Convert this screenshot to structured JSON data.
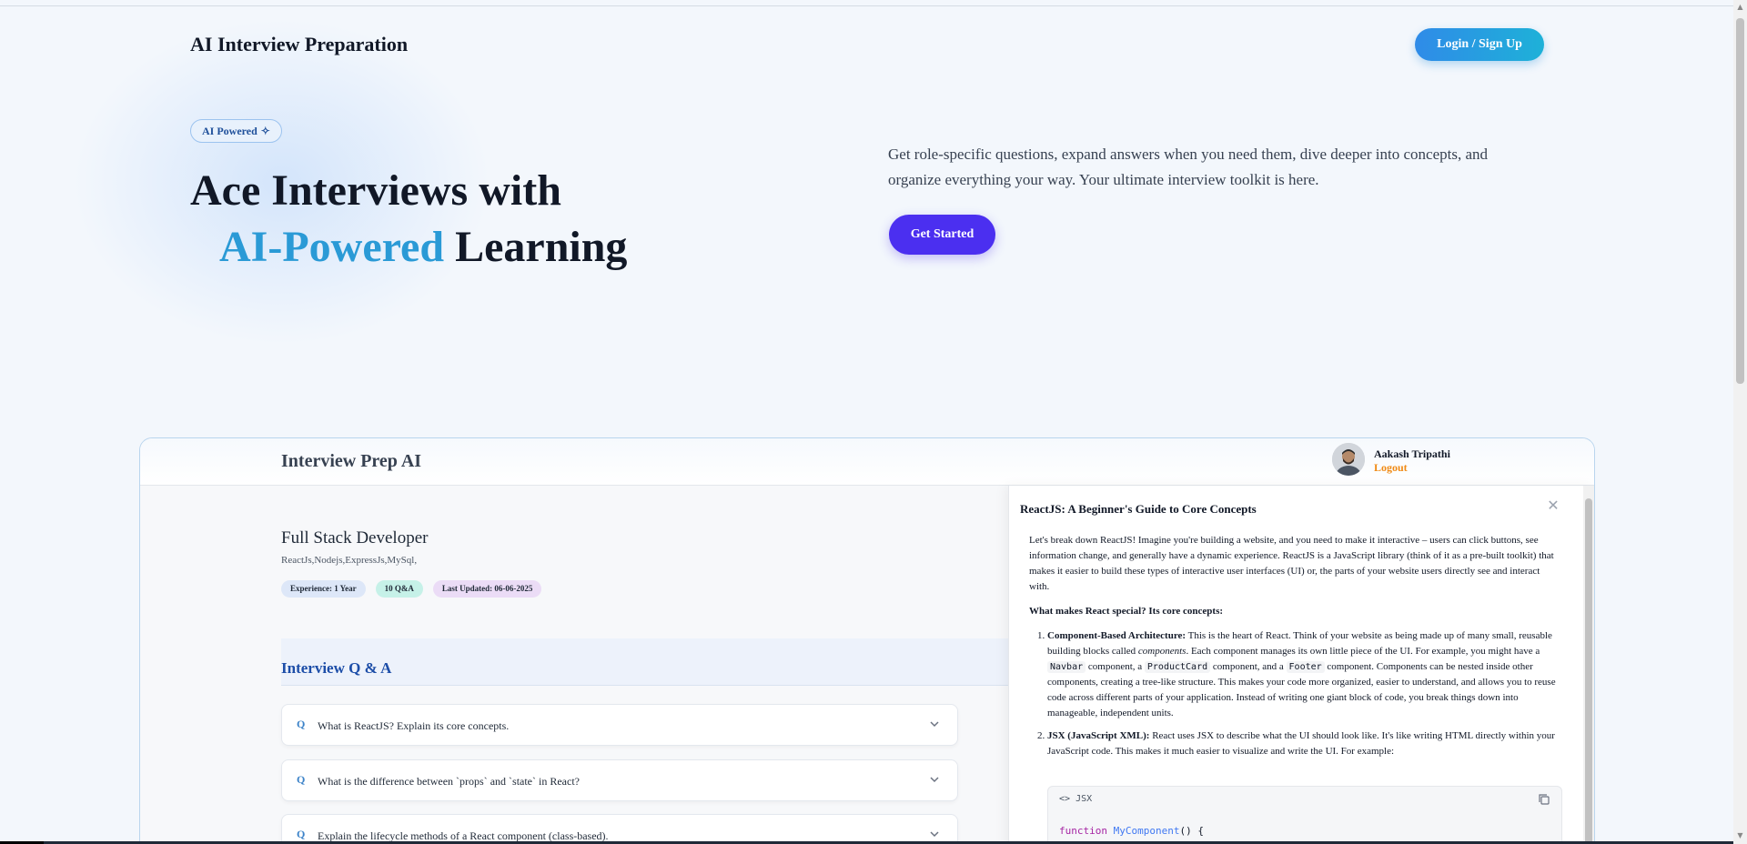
{
  "header": {
    "site_title": "AI Interview Preparation",
    "login_label": "Login / Sign Up"
  },
  "hero": {
    "badge": "AI Powered",
    "badge_icon": "sparkle-icon",
    "headline_line1": "Ace Interviews with",
    "headline_accent": "AI-Powered",
    "headline_rest": "Learning",
    "description": "Get role-specific questions, expand answers when you need them, dive deeper into concepts, and organize everything your way. Your ultimate interview toolkit is here.",
    "cta_label": "Get Started"
  },
  "preview": {
    "app_title": "Interview Prep AI",
    "user": {
      "name": "Aakash Tripathi",
      "logout_label": "Logout"
    },
    "session": {
      "role": "Full Stack Developer",
      "skills": "ReactJs,Nodejs,ExpressJs,MySql,",
      "tags": [
        "Experience: 1 Year",
        "10 Q&A",
        "Last Updated: 06-06-2025"
      ]
    },
    "qa_title": "Interview Q & A",
    "question_marker": "Q",
    "questions": [
      "What is ReactJS? Explain its core concepts.",
      "What is the difference between `props` and `state` in React?",
      "Explain the lifecycle methods of a React component (class-based)."
    ],
    "drawer": {
      "title": "ReactJS: A Beginner's Guide to Core Concepts",
      "close_icon": "close-icon",
      "intro": "Let's break down ReactJS! Imagine you're building a website, and you need to make it interactive – users can click buttons, see information change, and generally have a dynamic experience. ReactJS is a JavaScript library (think of it as a pre-built toolkit) that makes it easier to build these types of interactive user interfaces (UI) or, the parts of your website users directly see and interact with.",
      "subheading": "What makes React special? Its core concepts:",
      "items": [
        {
          "term": "Component-Based Architecture:",
          "text_a": " This is the heart of React. Think of your website as being made up of many small, reusable building blocks called ",
          "em": "components",
          "text_b": ". Each component manages its own little piece of the UI. For example, you might have a ",
          "code1": "Navbar",
          "text_c": " component, a ",
          "code2": "ProductCard",
          "text_d": " component, and a ",
          "code3": "Footer",
          "text_e": " component. Components can be nested inside other components, creating a tree-like structure. This makes your code more organized, easier to understand, and allows you to reuse code across different parts of your application. Instead of writing one giant block of code, you break things down into manageable, independent units."
        },
        {
          "term": "JSX (JavaScript XML):",
          "text_a": " React uses JSX to describe what the UI should look like. It's like writing HTML directly within your JavaScript code. This makes it much easier to visualize and write the UI. For example:"
        }
      ],
      "code_block": {
        "language": "JSX",
        "lang_icon": "code-brackets-icon",
        "copy_icon": "copy-icon",
        "keyword": "function",
        "fn_name": "MyComponent",
        "rest": "() {"
      }
    }
  },
  "colors": {
    "accent_blue": "#2a9ad6",
    "cta_purple": "#4b2ff0",
    "logout_orange": "#f08a14",
    "qa_title_blue": "#1d4ea8"
  }
}
